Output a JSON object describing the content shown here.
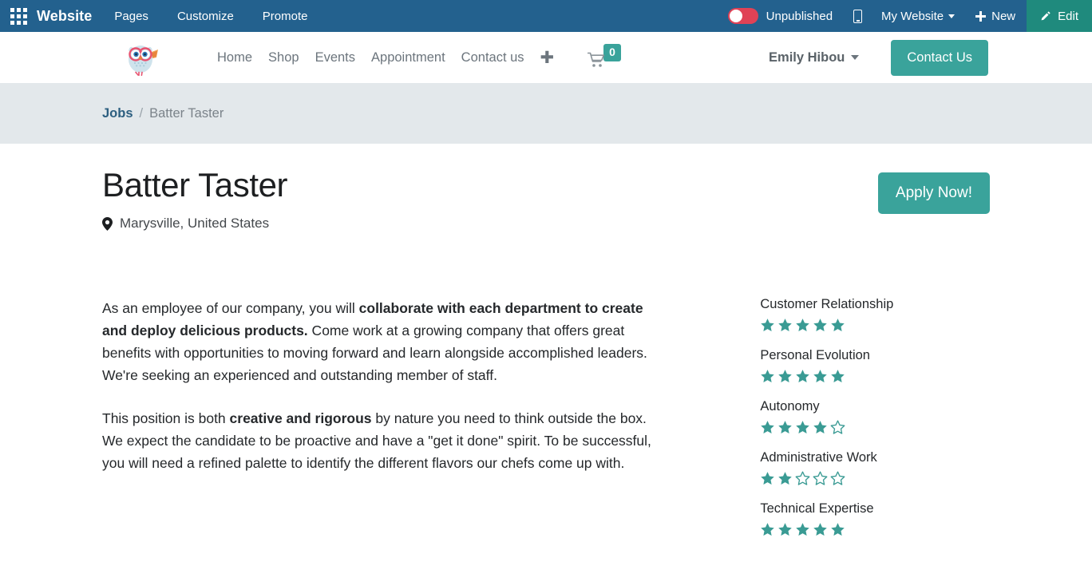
{
  "editor_bar": {
    "apps_icon": "apps-grid-icon",
    "brand": "Website",
    "menu": [
      "Pages",
      "Customize",
      "Promote"
    ],
    "publish_toggle": {
      "state": "off",
      "label": "Unpublished",
      "track_color": "#E04256"
    },
    "mobile_preview_icon": "mobile-phone-icon",
    "site_selector": "My Website",
    "new_label": "New",
    "edit_label": "Edit",
    "bar_color": "#23618E",
    "edit_color": "#1F8A7D"
  },
  "site_header": {
    "logo_alt": "owl-logo",
    "nav": [
      "Home",
      "Shop",
      "Events",
      "Appointment",
      "Contact us"
    ],
    "add_page_icon": "plus-icon",
    "cart_icon": "shopping-cart-icon",
    "cart_count": "0",
    "user_name": "Emily Hibou",
    "contact_button": "Contact Us",
    "accent_color": "#3AA39B"
  },
  "breadcrumb": {
    "parent": "Jobs",
    "separator": "/",
    "current": "Batter Taster",
    "band_color": "#E3E8EB"
  },
  "job": {
    "title": "Batter Taster",
    "location_icon": "map-pin-icon",
    "location": "Marysville, United States",
    "apply_button": "Apply Now!",
    "paragraphs": [
      {
        "parts": [
          {
            "text": "As an employee of our company, you will ",
            "bold": false
          },
          {
            "text": "collaborate with each department to create and deploy delicious products.",
            "bold": true
          },
          {
            "text": " Come work at a growing company that offers great benefits with opportunities to moving forward and learn alongside accomplished leaders. We're seeking an experienced and outstanding member of staff.",
            "bold": false
          }
        ]
      },
      {
        "parts": [
          {
            "text": "This position is both ",
            "bold": false
          },
          {
            "text": "creative and rigorous",
            "bold": true
          },
          {
            "text": " by nature you need to think outside the box. We expect the candidate to be proactive and have a \"get it done\" spirit. To be successful, you will need a refined palette to identify the different flavors our chefs come up with.",
            "bold": false
          }
        ]
      }
    ],
    "skills": [
      {
        "name": "Customer Relationship",
        "rating": 5,
        "max": 5
      },
      {
        "name": "Personal Evolution",
        "rating": 5,
        "max": 5
      },
      {
        "name": "Autonomy",
        "rating": 4,
        "max": 5
      },
      {
        "name": "Administrative Work",
        "rating": 2,
        "max": 5
      },
      {
        "name": "Technical Expertise",
        "rating": 5,
        "max": 5
      }
    ],
    "star_color": "#3A9B94"
  }
}
